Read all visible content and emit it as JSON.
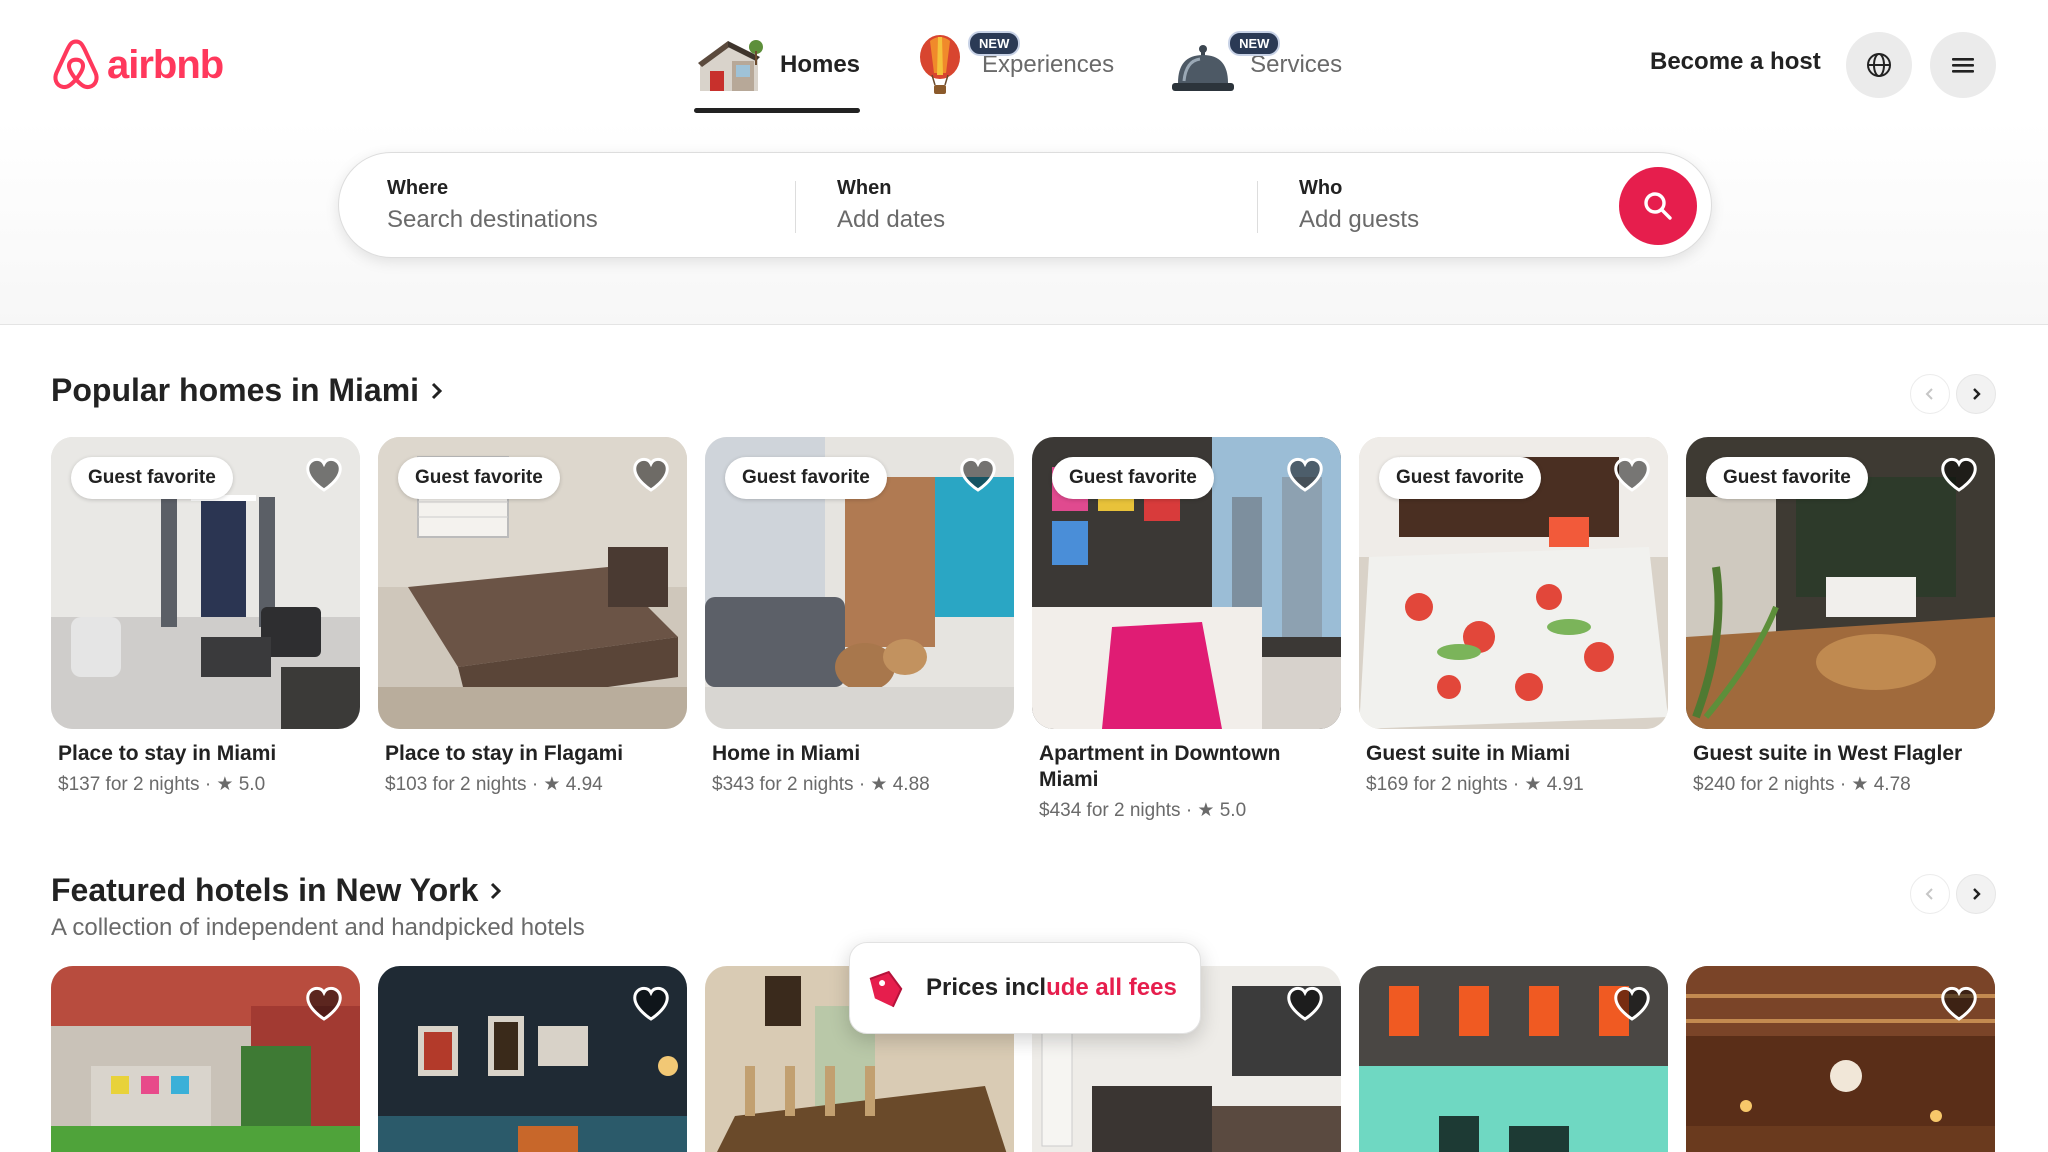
{
  "brand": {
    "name": "airbnb",
    "color": "#ff385c",
    "accent": "#e61e4d"
  },
  "nav": {
    "tabs": [
      {
        "label": "Homes",
        "icon": "house-icon",
        "active": true,
        "badge": ""
      },
      {
        "label": "Experiences",
        "icon": "hot-air-balloon-icon",
        "active": false,
        "badge": "NEW"
      },
      {
        "label": "Services",
        "icon": "service-bell-icon",
        "active": false,
        "badge": "NEW"
      }
    ],
    "host_label": "Become a host"
  },
  "search": {
    "where": {
      "label": "Where",
      "placeholder": "Search destinations"
    },
    "when": {
      "label": "When",
      "placeholder": "Add dates"
    },
    "who": {
      "label": "Who",
      "placeholder": "Add guests"
    }
  },
  "sections": [
    {
      "title": "Popular homes in Miami",
      "subtitle": "",
      "listings": [
        {
          "badge": "Guest favorite",
          "title": "Place to stay in Miami",
          "meta": "$137 for 2 nights · ★ 5.0"
        },
        {
          "badge": "Guest favorite",
          "title": "Place to stay in Flagami",
          "meta": "$103 for 2 nights · ★ 4.94"
        },
        {
          "badge": "Guest favorite",
          "title": "Home in Miami",
          "meta": "$343 for 2 nights · ★ 4.88"
        },
        {
          "badge": "Guest favorite",
          "title": "Apartment in Downtown Miami",
          "meta": "$434 for 2 nights · ★ 5.0"
        },
        {
          "badge": "Guest favorite",
          "title": "Guest suite in Miami",
          "meta": "$169 for 2 nights · ★ 4.91"
        },
        {
          "badge": "Guest favorite",
          "title": "Guest suite in West Flagler",
          "meta": "$240 for 2 nights · ★ 4.78"
        }
      ]
    },
    {
      "title": "Featured hotels in New York",
      "subtitle": "A collection of independent and handpicked hotels",
      "listings": [
        {},
        {},
        {},
        {},
        {},
        {}
      ]
    }
  ],
  "fees_banner": {
    "prefix": "Prices ",
    "highlight_pre": "incl",
    "mid": "ude",
    "highlight": " all fees"
  }
}
